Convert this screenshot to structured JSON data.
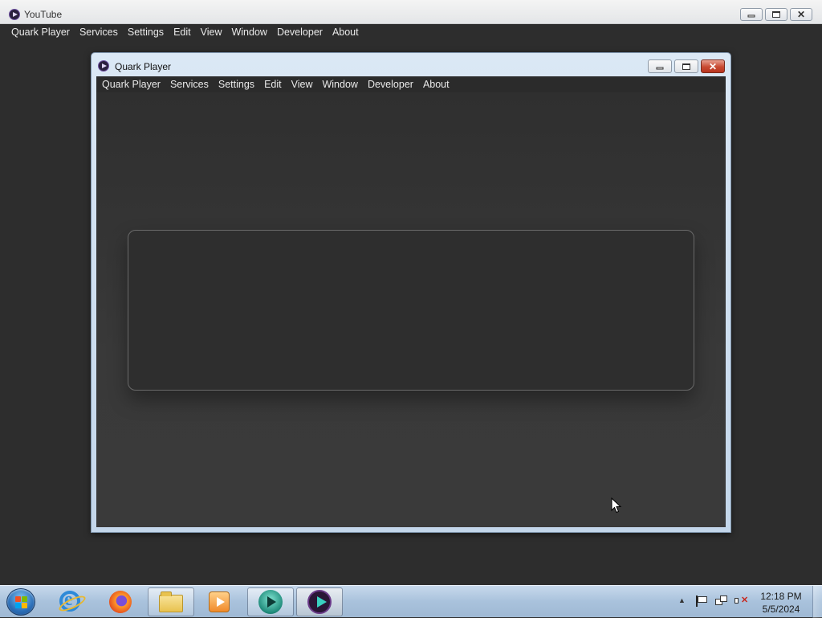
{
  "outer_window": {
    "title": "YouTube",
    "menu": [
      "Quark Player",
      "Services",
      "Settings",
      "Edit",
      "View",
      "Window",
      "Developer",
      "About"
    ]
  },
  "inner_window": {
    "title": "Quark Player",
    "menu": [
      "Quark Player",
      "Services",
      "Settings",
      "Edit",
      "View",
      "Window",
      "Developer",
      "About"
    ]
  },
  "taskbar": {
    "items": [
      {
        "name": "internet-explorer",
        "icon": "internet-explorer-icon",
        "active": false
      },
      {
        "name": "firefox",
        "icon": "firefox-icon",
        "active": false
      },
      {
        "name": "file-explorer",
        "icon": "folder-icon",
        "active": true
      },
      {
        "name": "media-player",
        "icon": "media-player-icon",
        "active": false
      },
      {
        "name": "teal-player",
        "icon": "teal-player-icon",
        "active": true
      },
      {
        "name": "quark-player",
        "icon": "quark-player-icon",
        "active": true
      }
    ],
    "clock": {
      "time": "12:18 PM",
      "date": "5/5/2024"
    }
  },
  "colors": {
    "window_bg": "#2d2d2d",
    "panel_border": "#6a6a6a",
    "taskbar": "#a9c2dc",
    "close_red": "#c84a32"
  }
}
